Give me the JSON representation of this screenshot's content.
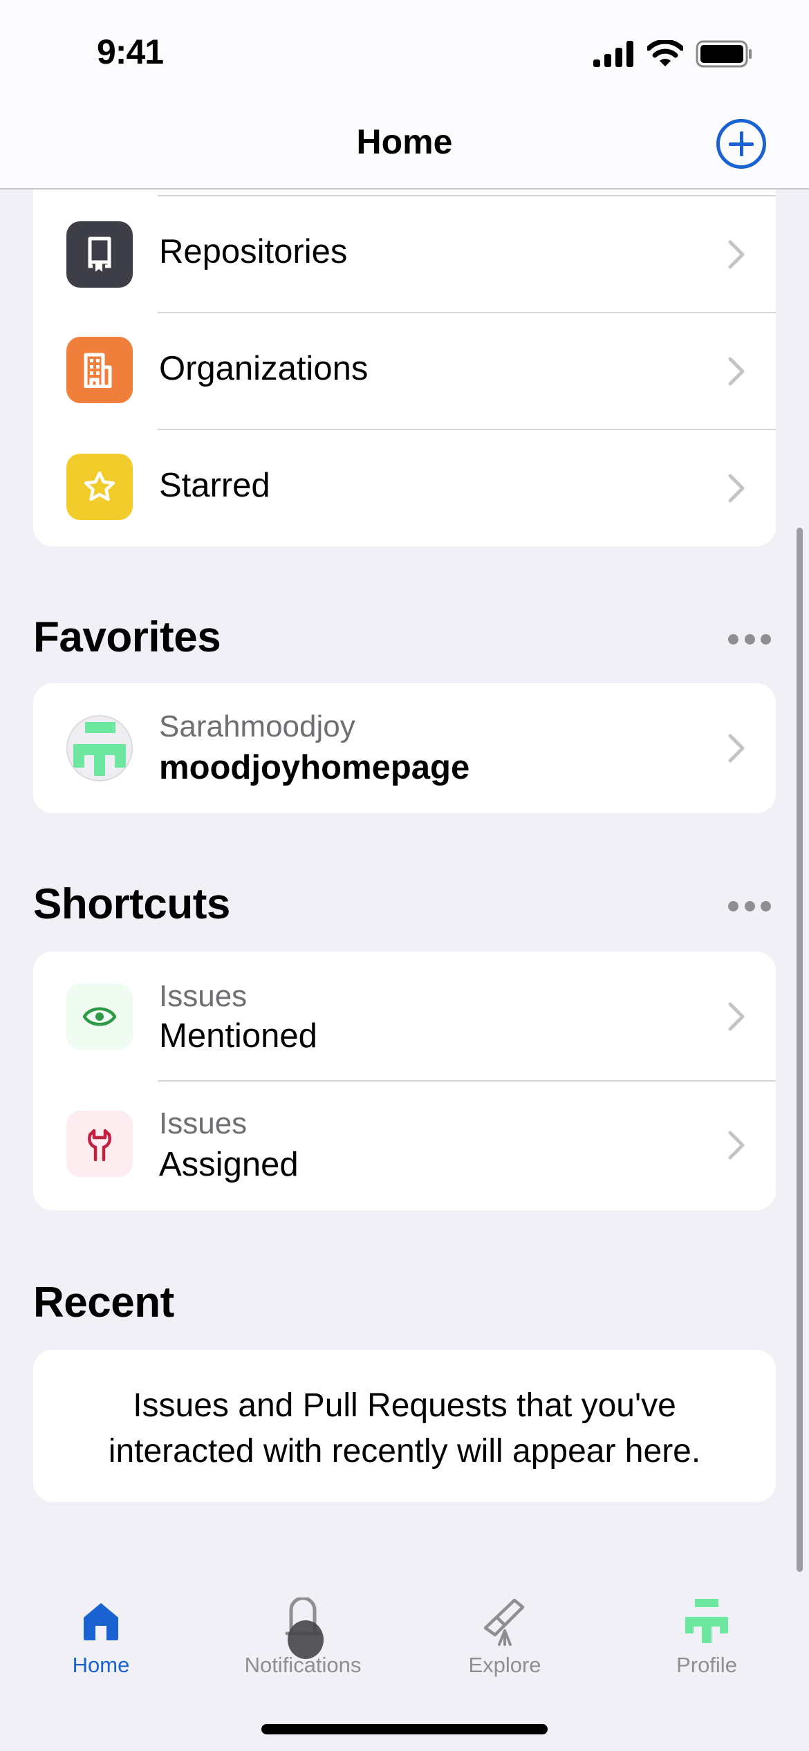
{
  "status_bar": {
    "time": "9:41",
    "icons": [
      "cellular-signal-icon",
      "wifi-icon",
      "battery-icon"
    ]
  },
  "header": {
    "title": "Home",
    "add_button_icon": "plus-circle-icon"
  },
  "my_work": {
    "items": [
      {
        "label": "Repositories",
        "icon": "repo-book-icon",
        "icon_bg": "#3d3e47"
      },
      {
        "label": "Organizations",
        "icon": "organization-building-icon",
        "icon_bg": "#f07f3b"
      },
      {
        "label": "Starred",
        "icon": "star-icon",
        "icon_bg": "#f2cc2b"
      }
    ]
  },
  "favorites": {
    "title": "Favorites",
    "more_icon": "ellipsis-icon",
    "items": [
      {
        "owner": "Sarahmoodjoy",
        "repo": "moodjoyhomepage",
        "icon": "identicon-avatar"
      }
    ]
  },
  "shortcuts": {
    "title": "Shortcuts",
    "more_icon": "ellipsis-icon",
    "items": [
      {
        "type": "Issues",
        "label": "Mentioned",
        "icon": "eye-icon",
        "icon_color": "#2e9a48",
        "icon_bg": "#f0fbf1"
      },
      {
        "type": "Issues",
        "label": "Assigned",
        "icon": "wrench-icon",
        "icon_color": "#c2213f",
        "icon_bg": "#fdedf0"
      }
    ]
  },
  "recent": {
    "title": "Recent",
    "empty_message": "Issues and Pull Requests that you've interacted with recently will appear here."
  },
  "tab_bar": {
    "active": "Home",
    "tabs": [
      {
        "label": "Home",
        "icon": "home-icon"
      },
      {
        "label": "Notifications",
        "icon": "bell-icon"
      },
      {
        "label": "Explore",
        "icon": "telescope-icon"
      },
      {
        "label": "Profile",
        "icon": "identicon-avatar"
      }
    ]
  },
  "colors": {
    "accent": "#1a62d2",
    "background": "#f1f0f6",
    "identicon": "#6ee7a0",
    "secondary_text": "#6e6e73"
  }
}
